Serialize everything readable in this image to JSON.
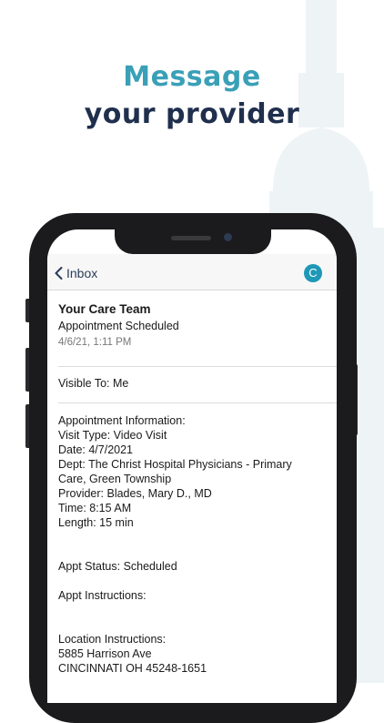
{
  "headline": {
    "line1": "Message",
    "line2": "your provider"
  },
  "nav": {
    "back_label": "Inbox",
    "avatar_initial": "C"
  },
  "message": {
    "sender": "Your Care Team",
    "subject": "Appointment Scheduled",
    "date": "4/6/21, 1:11 PM",
    "visible_to": "Visible To: Me",
    "body": {
      "info_header": "Appointment Information:",
      "visit_type": "Visit Type: Video Visit",
      "date": "Date: 4/7/2021",
      "dept_line1": "Dept: The Christ Hospital Physicians - Primary",
      "dept_line2": "Care, Green Township",
      "provider": "Provider: Blades, Mary D., MD",
      "time": "Time: 8:15 AM",
      "length": "Length: 15 min",
      "status": "Appt Status: Scheduled",
      "instructions": "Appt Instructions:",
      "location_header": "Location Instructions:",
      "address1": "5885 Harrison Ave",
      "address2": "CINCINNATI OH 45248-1651"
    }
  },
  "colors": {
    "accent": "#3aa0b7",
    "navy": "#1f2f4d",
    "avatar": "#1e98b6"
  }
}
